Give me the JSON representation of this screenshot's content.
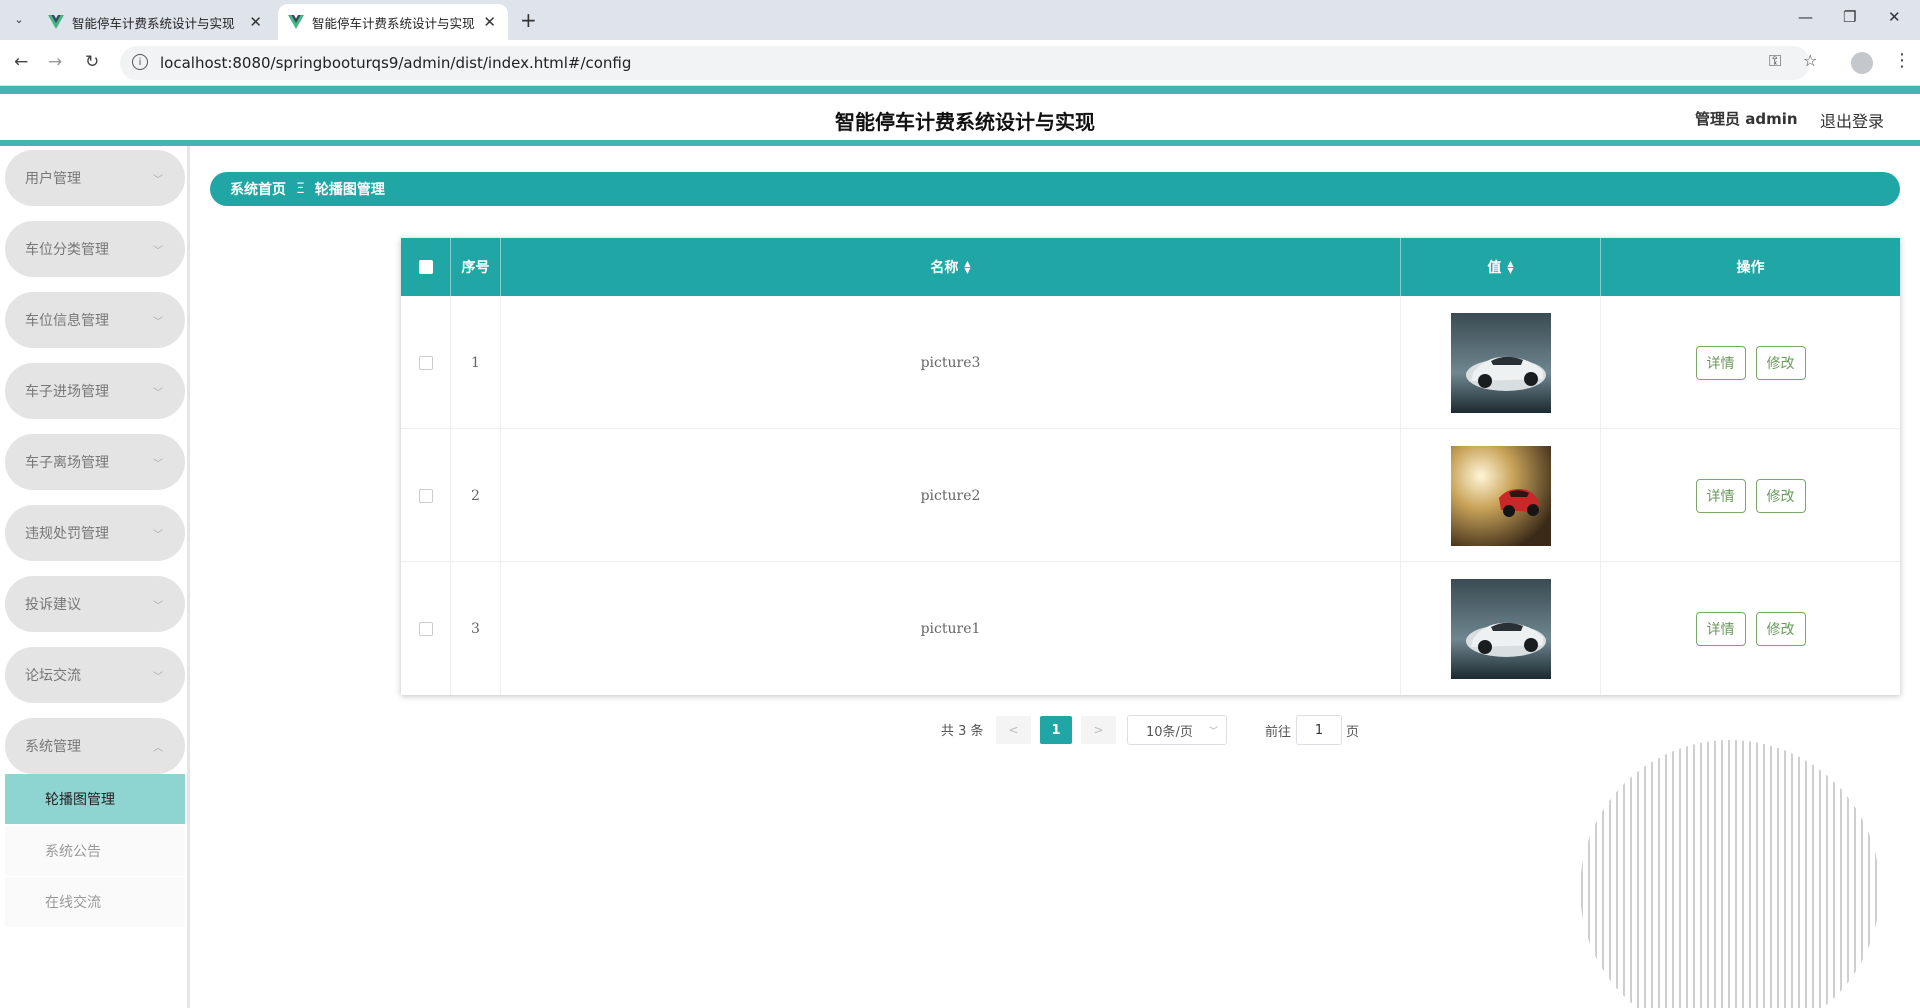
{
  "browser": {
    "tabs": [
      {
        "label": "智能停车计费系统设计与实现"
      },
      {
        "label": "智能停车计费系统设计与实现"
      }
    ],
    "url": "localhost:8080/springbooturqs9/admin/dist/index.html#/config"
  },
  "header": {
    "title": "智能停车计费系统设计与实现",
    "user_label": "管理员 admin",
    "logout_label": "退出登录"
  },
  "sidebar": {
    "items": [
      {
        "label": "用户管理"
      },
      {
        "label": "车位分类管理"
      },
      {
        "label": "车位信息管理"
      },
      {
        "label": "车子进场管理"
      },
      {
        "label": "车子离场管理"
      },
      {
        "label": "违规处罚管理"
      },
      {
        "label": "投诉建议"
      },
      {
        "label": "论坛交流"
      },
      {
        "label": "系统管理"
      }
    ],
    "sub_items": [
      {
        "label": "轮播图管理",
        "active": true
      },
      {
        "label": "系统公告",
        "active": false
      },
      {
        "label": "在线交流",
        "active": false
      }
    ]
  },
  "breadcrumb": {
    "home": "系统首页",
    "separator": "Ξ",
    "current": "轮播图管理"
  },
  "table": {
    "columns": {
      "index": "序号",
      "name": "名称",
      "value": "值",
      "actions": "操作"
    },
    "rows": [
      {
        "index": "1",
        "name": "picture3",
        "image": "white-sports-car"
      },
      {
        "index": "2",
        "name": "picture2",
        "image": "red-sports-car"
      },
      {
        "index": "3",
        "name": "picture1",
        "image": "white-sports-car"
      }
    ],
    "detail_label": "详情",
    "edit_label": "修改"
  },
  "pagination": {
    "total": "共 3 条",
    "prev": "<",
    "current_page": "1",
    "next": ">",
    "page_size": "10条/页",
    "goto_prefix": "前往",
    "goto_value": "1",
    "goto_suffix": "页"
  },
  "colors": {
    "accent": "#20a7a5",
    "accent_light": "#8ed4d1",
    "header_stripe": "#43b4b2"
  }
}
